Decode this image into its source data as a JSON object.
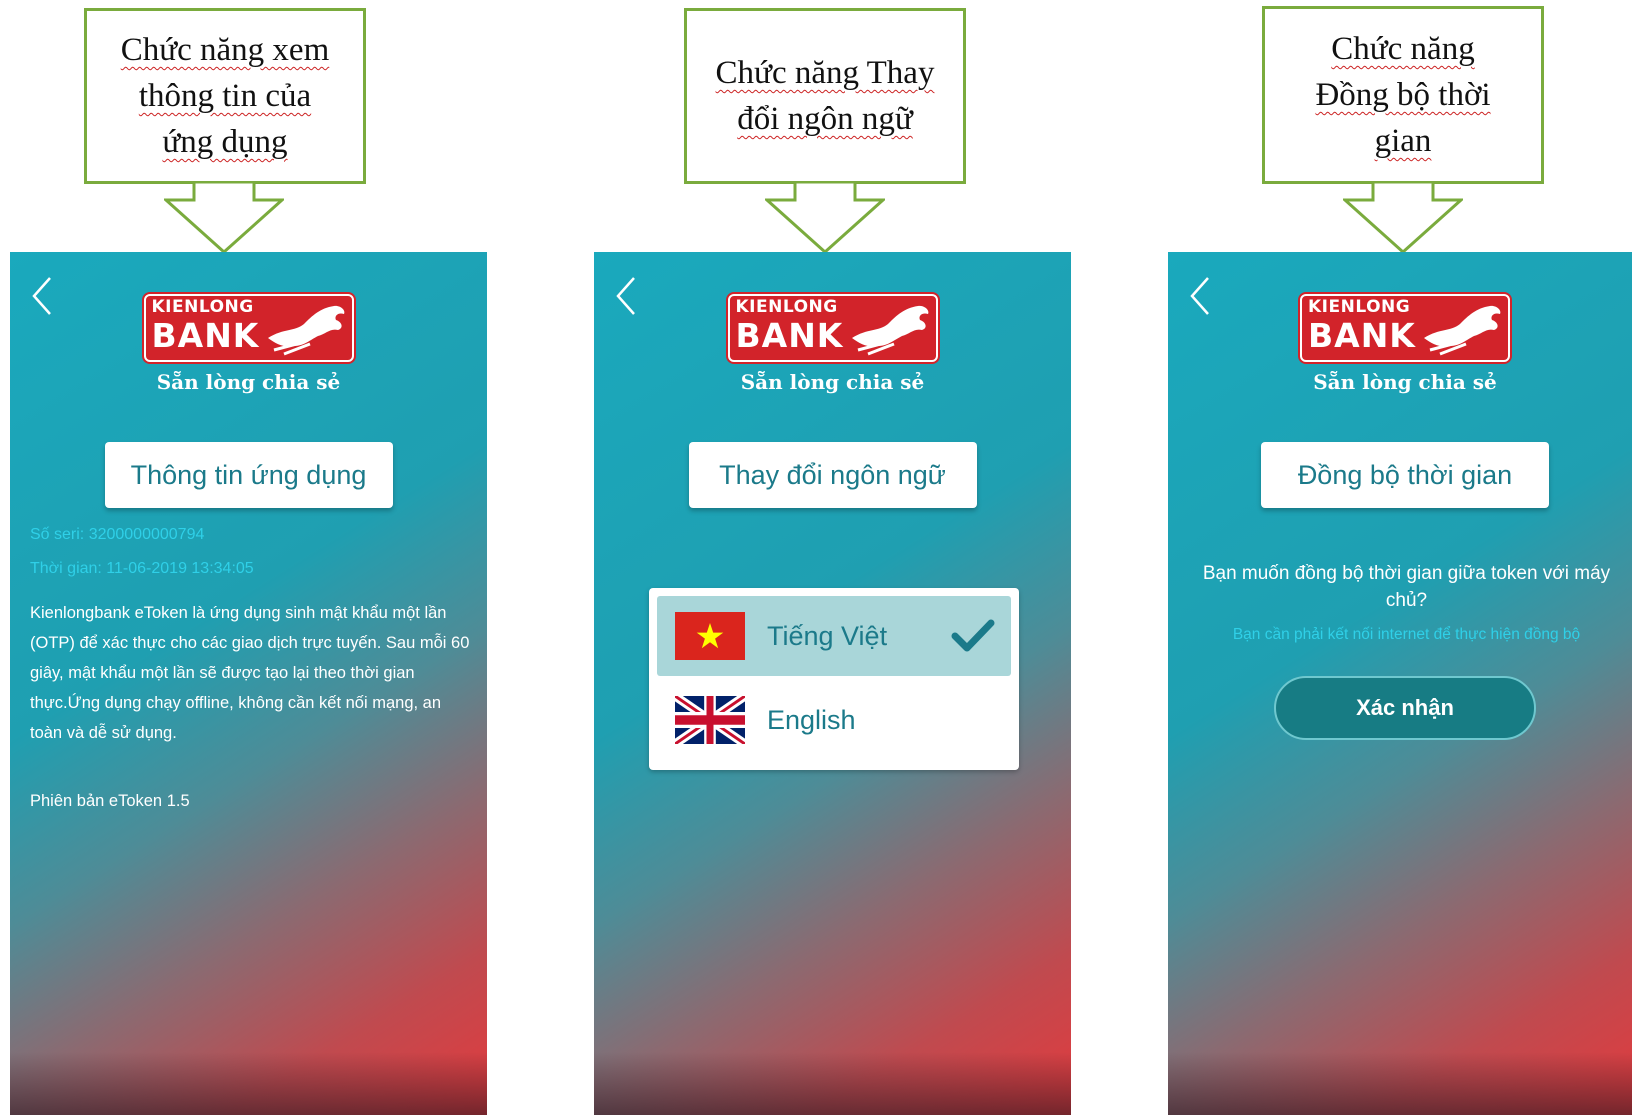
{
  "callouts": [
    "Chức năng xem\nthông tin của\nứng dụng",
    "Chức năng Thay\nđổi ngôn ngữ",
    "Chức năng\nĐồng bộ thời\ngian"
  ],
  "brand": {
    "logo_top": "KIENLONG",
    "logo_main": "BANK",
    "slogan": "Sẵn lòng chia sẻ",
    "primary_color": "#1aa9bd",
    "accent_color": "#e33a3d",
    "logo_color": "#d2232a"
  },
  "screen_info": {
    "title": "Thông tin ứng dụng",
    "serial": "Số seri: 3200000000794",
    "time": "Thời gian:  11-06-2019 13:34:05",
    "description": "Kienlongbank eToken là ứng dụng sinh mật khẩu một lần (OTP) để xác thực cho các giao dịch trực tuyến. Sau mỗi 60 giây, mật khẩu một lần sẽ được tạo lại theo thời gian thực.Ứng dụng chạy offline, không cần kết nối mạng, an toàn và dễ sử dụng.",
    "version": "Phiên bản eToken 1.5"
  },
  "screen_language": {
    "title": "Thay đổi ngôn ngữ",
    "options": [
      {
        "label": "Tiếng Việt",
        "flag": "vietnam-flag-icon",
        "selected": true
      },
      {
        "label": "English",
        "flag": "uk-flag-icon",
        "selected": false
      }
    ]
  },
  "screen_sync": {
    "title": "Đồng bộ thời gian",
    "question": "Bạn muốn đồng bộ thời gian giữa token với máy chủ?",
    "note": "Bạn cần phải kết nối internet để thực hiện đồng bộ",
    "confirm_label": "Xác nhận"
  },
  "icons": {
    "back": "chevron-left-icon",
    "check": "check-icon"
  }
}
